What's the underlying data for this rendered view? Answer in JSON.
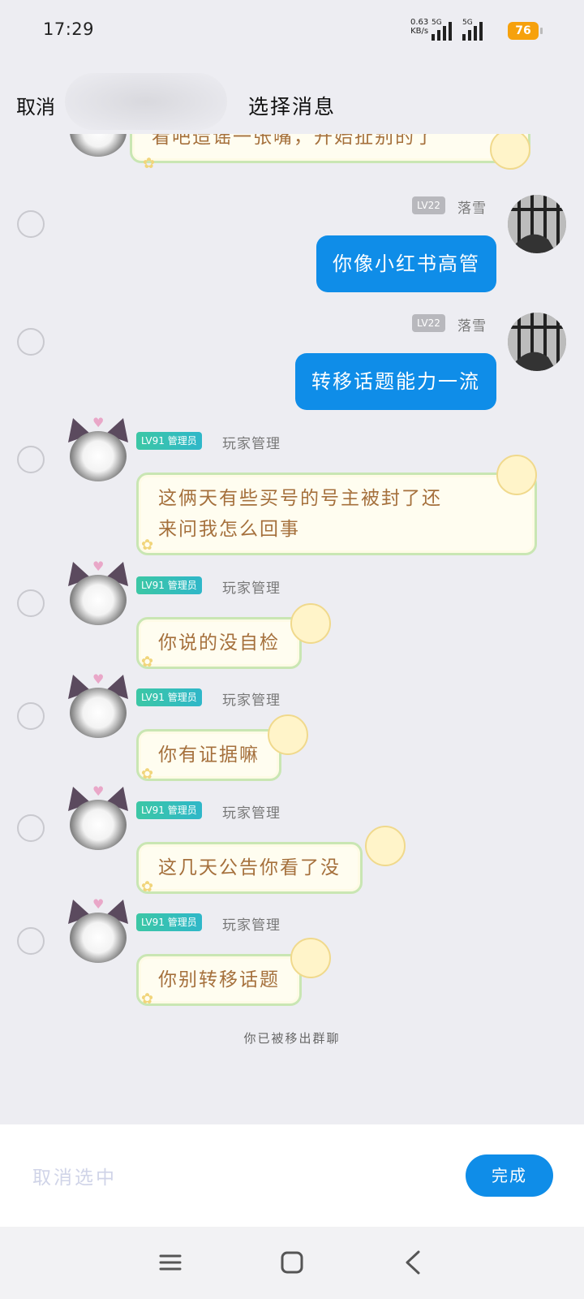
{
  "status": {
    "time": "17:29",
    "net_speed": "0.63",
    "net_unit": "KB/s",
    "sim1_label": "5G",
    "sim2_label": "5G",
    "battery": "76",
    "battery_color": "#f6a10d"
  },
  "header": {
    "cancel_label": "取消",
    "title": "选择消息"
  },
  "messages": [
    {
      "side": "left",
      "text": "看吧造谣一张嘴，开始扯别的了",
      "partial": true
    },
    {
      "side": "right",
      "level": "LV22",
      "nickname": "落雪",
      "text": "你像小红书高管"
    },
    {
      "side": "right",
      "level": "LV22",
      "nickname": "落雪",
      "text": "转移话题能力一流"
    },
    {
      "side": "left",
      "level": "LV91",
      "role": "管理员",
      "nickname": "玩家管理",
      "text_line1": "这俩天有些买号的号主被封了还",
      "text_line2": "来问我怎么回事"
    },
    {
      "side": "left",
      "level": "LV91",
      "role": "管理员",
      "nickname": "玩家管理",
      "text": "你说的没自检"
    },
    {
      "side": "left",
      "level": "LV91",
      "role": "管理员",
      "nickname": "玩家管理",
      "text": "你有证据嘛"
    },
    {
      "side": "left",
      "level": "LV91",
      "role": "管理员",
      "nickname": "玩家管理",
      "text": "这几天公告你看了没"
    },
    {
      "side": "left",
      "level": "LV91",
      "role": "管理员",
      "nickname": "玩家管理",
      "text": "你别转移话题"
    }
  ],
  "system_notice": "你已被移出群聊",
  "bottom": {
    "clear_label": "取消选中",
    "done_label": "完成"
  },
  "colors": {
    "accent": "#0f8de8",
    "background": "#ededf2",
    "admin_badge": "#3cc7a5"
  },
  "icons": {
    "nav_menu": "menu-icon",
    "nav_home": "square-home-icon",
    "nav_back": "back-chevron-icon"
  }
}
